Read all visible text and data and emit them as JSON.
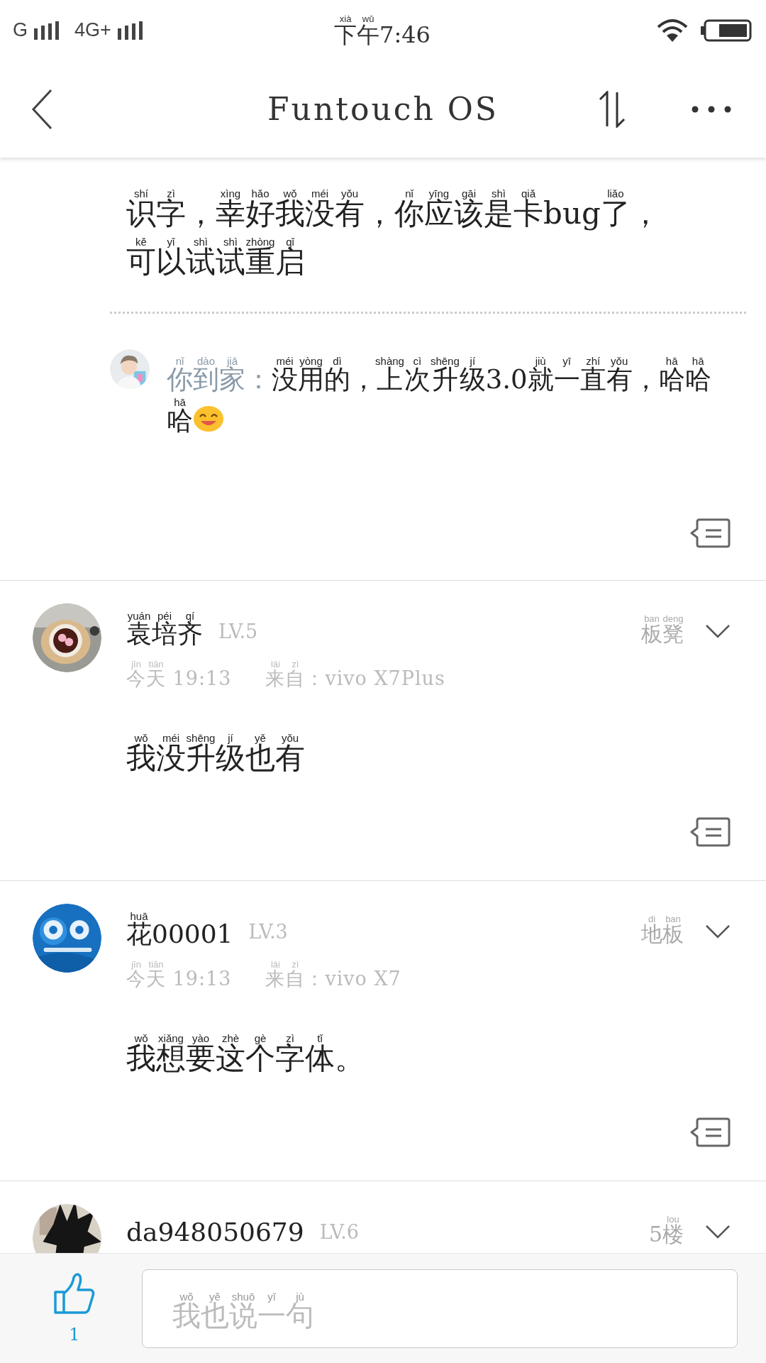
{
  "status_bar": {
    "network_1": "G",
    "network_2": "4G+",
    "time": [
      [
        "xià",
        "下"
      ],
      [
        "wǔ",
        "午"
      ],
      [
        "7:46"
      ]
    ]
  },
  "header": {
    "title": "Funtouch OS"
  },
  "thread": {
    "lines": [
      [
        [
          "shí",
          "识"
        ],
        [
          "zì",
          "字"
        ],
        [
          "，"
        ],
        [
          "xìng",
          "幸"
        ],
        [
          "hǎo",
          "好"
        ],
        [
          "wǒ",
          "我"
        ],
        [
          "méi",
          "没"
        ],
        [
          "yǒu",
          "有"
        ],
        [
          "，"
        ],
        [
          "nǐ",
          "你"
        ],
        [
          "yīng",
          "应"
        ],
        [
          "gāi",
          "该"
        ],
        [
          "shì",
          "是"
        ],
        [
          "qiǎ",
          "卡"
        ],
        [
          "bug"
        ],
        [
          "liǎo",
          "了"
        ],
        [
          "，"
        ]
      ],
      [
        [
          "kě",
          "可"
        ],
        [
          "yǐ",
          "以"
        ],
        [
          "shì",
          "试"
        ],
        [
          "shì",
          "试"
        ],
        [
          "zhòng",
          "重"
        ],
        [
          "qǐ",
          "启"
        ]
      ]
    ],
    "replies": [
      {
        "author": [
          [
            "nǐ",
            "你"
          ],
          [
            "dào",
            "到"
          ],
          [
            "jiā",
            "家"
          ],
          [
            "："
          ]
        ],
        "lines": [
          [
            [
              "méi",
              "没"
            ],
            [
              "yòng",
              "用"
            ],
            [
              "dì",
              "的"
            ],
            [
              "，"
            ],
            [
              "shàng",
              "上"
            ],
            [
              "cì",
              "次"
            ],
            [
              "shēng",
              "升"
            ],
            [
              "jí",
              "级"
            ],
            [
              "3.0"
            ],
            [
              "jiù",
              "就"
            ],
            [
              "yī",
              "一"
            ],
            [
              "zhí",
              "直"
            ],
            [
              "yǒu",
              "有"
            ],
            [
              "，"
            ],
            [
              "hā",
              "哈"
            ],
            [
              "hā",
              "哈"
            ]
          ],
          [
            [
              "hā",
              "哈"
            ]
          ]
        ]
      }
    ]
  },
  "comments": [
    {
      "author": [
        [
          "yuán",
          "袁"
        ],
        [
          "péi",
          "培"
        ],
        [
          "qí",
          "齐"
        ]
      ],
      "level": "LV.5",
      "floor": [
        [
          "ban",
          "板"
        ],
        [
          "deng",
          "凳"
        ]
      ],
      "time": [
        [
          "jīn",
          "今"
        ],
        [
          "tiān",
          "天"
        ],
        [
          " 19:13"
        ]
      ],
      "source": [
        [
          "lái",
          "来"
        ],
        [
          "zì",
          "自"
        ],
        [
          "：vivo X7Plus"
        ]
      ],
      "body": [
        [
          [
            "wǒ",
            "我"
          ],
          [
            "méi",
            "没"
          ],
          [
            "shēng",
            "升"
          ],
          [
            "jí",
            "级"
          ],
          [
            "yě",
            "也"
          ],
          [
            "yǒu",
            "有"
          ]
        ]
      ]
    },
    {
      "author": [
        [
          "huā",
          "花"
        ],
        [
          "00001"
        ]
      ],
      "level": "LV.3",
      "floor": [
        [
          "di",
          "地"
        ],
        [
          "ban",
          "板"
        ]
      ],
      "time": [
        [
          "jīn",
          "今"
        ],
        [
          "tiān",
          "天"
        ],
        [
          " 19:13"
        ]
      ],
      "source": [
        [
          "lái",
          "来"
        ],
        [
          "zì",
          "自"
        ],
        [
          "：vivo X7"
        ]
      ],
      "body": [
        [
          [
            "wǒ",
            "我"
          ],
          [
            "xiǎng",
            "想"
          ],
          [
            "yào",
            "要"
          ],
          [
            "zhè",
            "这"
          ],
          [
            "gè",
            "个"
          ],
          [
            "zì",
            "字"
          ],
          [
            "tǐ",
            "体"
          ],
          [
            "。"
          ]
        ]
      ]
    },
    {
      "author": [
        [
          "da948050679"
        ]
      ],
      "level": "LV.6",
      "floor": [
        [
          "5"
        ],
        [
          "lou",
          "楼"
        ]
      ]
    }
  ],
  "bottom_bar": {
    "likes": "1",
    "placeholder": [
      [
        "wǒ",
        "我"
      ],
      [
        "yě",
        "也"
      ],
      [
        "shuō",
        "说"
      ],
      [
        "yī",
        "一"
      ],
      [
        "jù",
        "句"
      ]
    ]
  }
}
